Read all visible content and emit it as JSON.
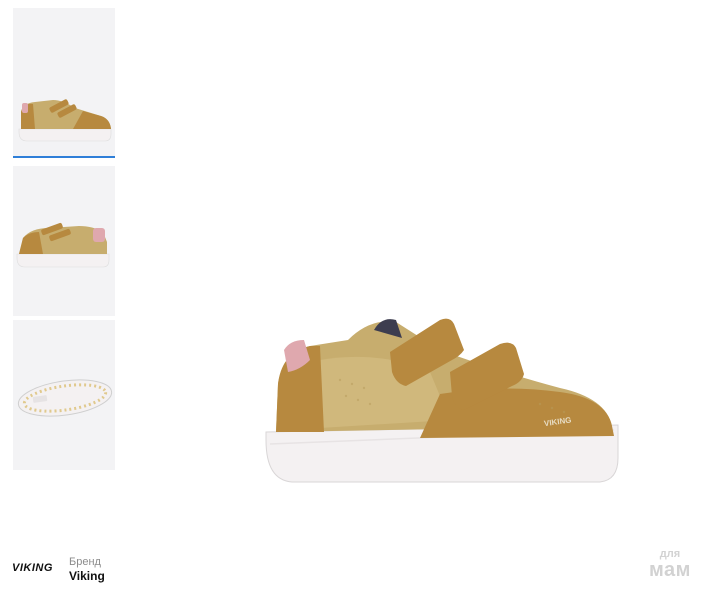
{
  "gallery": {
    "thumbnails": [
      {
        "view": "side",
        "active": true
      },
      {
        "view": "side-angle",
        "active": false
      },
      {
        "view": "sole",
        "active": false
      }
    ],
    "active_indicator_color": "#2f7fd8"
  },
  "product_image": {
    "shoe_brand_mark": "VIKING",
    "colors": {
      "suede": "#b7893f",
      "metallic": "#c7ad6e",
      "heel_tab": "#dfa8ae",
      "sole": "#f4f1f2"
    }
  },
  "brand": {
    "logo_text": "VIKING",
    "caption": "Бренд",
    "name": "Viking"
  },
  "watermark": {
    "line1": "для",
    "line2": "мам"
  }
}
